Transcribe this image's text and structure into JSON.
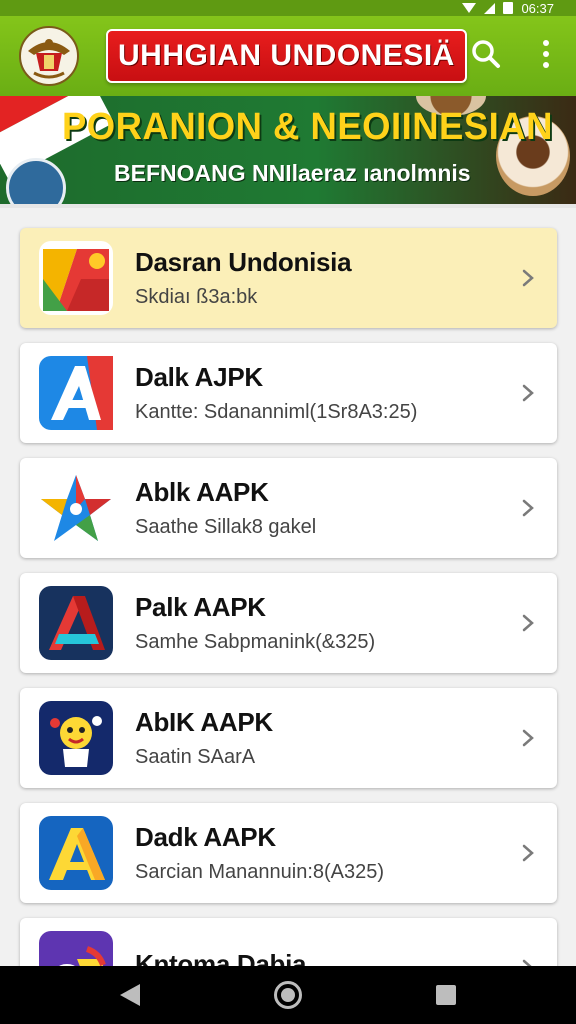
{
  "status_bar": {
    "time": "06:37"
  },
  "app_bar": {
    "title": "UHHGIAN UNDONESIÄ"
  },
  "banner": {
    "title": "PORANION & NEOIINESIAN",
    "subtitle": "BEFNOANG NNIlaeraz ıanolmnis"
  },
  "apps": [
    {
      "name": "Dasran Undonisia",
      "subtitle": "Skdiaı ß3a:bk",
      "icon": "red-yellow-green-fold-logo-icon",
      "highlight": true
    },
    {
      "name": "Dalk AJPK",
      "subtitle": "Kantte: Sdananniml(1Sr8A3:25)",
      "icon": "blue-letter-a-icon",
      "highlight": false
    },
    {
      "name": "Ablk AAPK",
      "subtitle": "Saathe Sillak8 gakel",
      "icon": "colorful-star-logo-icon",
      "highlight": false
    },
    {
      "name": "Palk AAPK",
      "subtitle": "Samhe Sabpmanink(&325)",
      "icon": "dark-blue-red-a-icon",
      "highlight": false
    },
    {
      "name": "AbIK AAPK",
      "subtitle": "Saatin SAarA",
      "icon": "cartoon-character-icon",
      "highlight": false
    },
    {
      "name": "Dadk AAPK",
      "subtitle": "Sarcian Manannuin:8(A325)",
      "icon": "yellow-letter-a-icon",
      "highlight": false
    },
    {
      "name": "Kntoma Dabia",
      "subtitle": "",
      "icon": "purple-yellow-ring-icon",
      "highlight": false
    }
  ],
  "colors": {
    "app_bar": "#7bbd18",
    "title_badge": "#d81515",
    "banner_title": "#ffd21a",
    "highlight_card": "#fbefb8"
  }
}
